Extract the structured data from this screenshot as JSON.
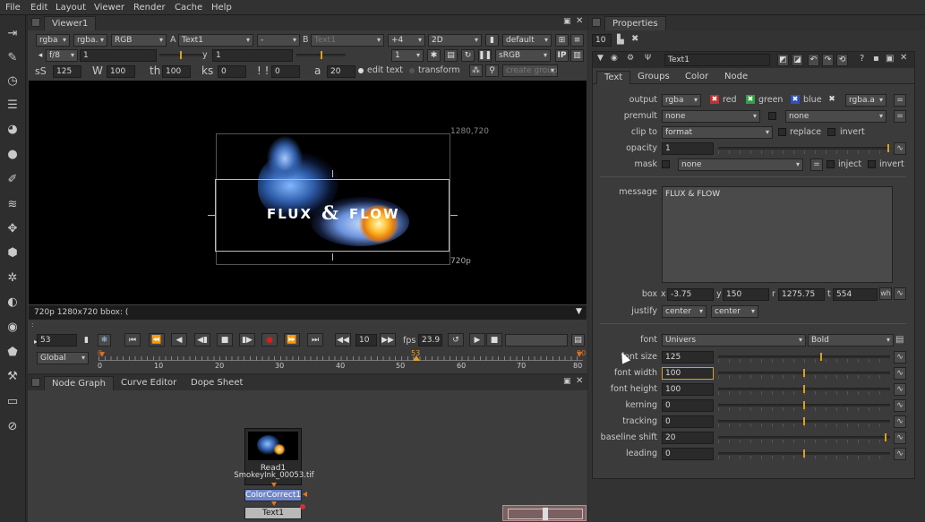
{
  "menu": [
    "File",
    "Edit",
    "Layout",
    "Viewer",
    "Render",
    "Cache",
    "Help"
  ],
  "viewer": {
    "tab": "Viewer1",
    "row1": {
      "channels": "rgba",
      "alpha": "rgba.",
      "display": "RGB",
      "a_label": "A",
      "a_input": "Text1",
      "a_op": "-",
      "b_label": "B",
      "b_input": "Text1",
      "wipe": "+4",
      "view": "2D",
      "lut": "default"
    },
    "row2": {
      "fstop": "f/8",
      "gain": "1",
      "y_label": "y",
      "gamma": "1",
      "proxy": "1",
      "colorspace": "sRGB",
      "ip": "IP"
    },
    "row3": {
      "size_label": "sS",
      "size": "125",
      "w_label": "W",
      "width": "100",
      "h_label": "th",
      "height": "100",
      "k_label": "ks",
      "kerning": "0",
      "t_label": "! !",
      "tracking": "0",
      "b_label": "a",
      "baseline": "20",
      "edit_text": "edit text",
      "transform": "transform",
      "create_group": "create group"
    },
    "format_top": "1280,720",
    "format_bottom": "720p",
    "title_left": "FLUX",
    "title_amp": "&",
    "title_right": "FLOW",
    "status": "720p 1280x720 bbox: (",
    "frame": "53",
    "step": "10",
    "fps_label": "fps",
    "fps": "23.9",
    "range_mode": "Global",
    "ruler": [
      "0",
      "10",
      "20",
      "30",
      "40",
      "50",
      "60",
      "70",
      "80"
    ],
    "range_start": "0",
    "range_end": "90",
    "current_marker": "53"
  },
  "nodegraph": {
    "tabs": [
      "Node Graph",
      "Curve Editor",
      "Dope Sheet"
    ],
    "nodes": [
      {
        "name": "Read1",
        "file": "SmokeyInk_00053.tif"
      },
      {
        "name": "ColorCorrect1"
      },
      {
        "name": "Text1"
      }
    ]
  },
  "properties": {
    "tab": "Properties",
    "max_panels": "10",
    "node_name": "Text1",
    "tabs": [
      "Text",
      "Groups",
      "Color",
      "Node"
    ],
    "output": {
      "label": "output",
      "value": "rgba",
      "red": "red",
      "green": "green",
      "blue": "blue",
      "alpha": "rgba.a"
    },
    "premult": {
      "label": "premult",
      "value": "none",
      "value2": "none"
    },
    "clip": {
      "label": "clip to",
      "value": "format",
      "replace": "replace",
      "invert": "invert"
    },
    "opacity": {
      "label": "opacity",
      "value": "1"
    },
    "mask": {
      "label": "mask",
      "value": "none",
      "inject": "inject",
      "invert": "invert"
    },
    "message": {
      "label": "message",
      "value": "FLUX & FLOW"
    },
    "box": {
      "label": "box",
      "x_label": "x",
      "x": "-3.75",
      "y_label": "y",
      "y": "150",
      "r_label": "r",
      "r": "1275.75",
      "t_label": "t",
      "t": "554",
      "wh": "wh"
    },
    "justify": {
      "label": "justify",
      "h": "center",
      "v": "center"
    },
    "font": {
      "label": "font",
      "family": "Univers",
      "style": "Bold"
    },
    "sliders": [
      {
        "label": "font size",
        "value": "125",
        "level": 0.6
      },
      {
        "label": "font width",
        "value": "100",
        "level": 0.5
      },
      {
        "label": "font height",
        "value": "100",
        "level": 0.5
      },
      {
        "label": "kerning",
        "value": "0",
        "level": 0.5
      },
      {
        "label": "tracking",
        "value": "0",
        "level": 0.5
      },
      {
        "label": "baseline shift",
        "value": "20",
        "level": 0.98
      },
      {
        "label": "leading",
        "value": "0",
        "level": 0.5
      }
    ]
  },
  "colors": {
    "accent": "#d9a020",
    "panel": "#3a3a3a",
    "viewer_bg": "#000000",
    "node_read": "#2a2a2a",
    "node_cc": "#6f86c9",
    "node_text": "#b9b9b9"
  }
}
